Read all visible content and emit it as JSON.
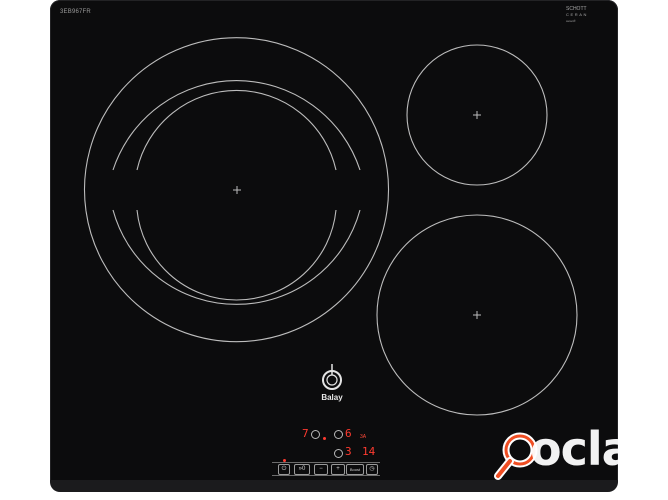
{
  "labels": {
    "model_code": "3EB967FR",
    "glass_brand": "SCHOTT",
    "glass_line": "CERAN",
    "glass_tiny": "ceran®",
    "brand_name": "Balay",
    "watermark": "oclasf"
  },
  "display": {
    "left_digit": "7",
    "left_small": "6",
    "mid_small": "3",
    "right_digits": "14",
    "tiny_label": "3A"
  },
  "controls": {
    "buttons": [
      "⏻",
      "»0",
      "−",
      "+",
      "Boost",
      "◷"
    ]
  },
  "colors": {
    "glass": "#0c0c0d",
    "zone_ring": "#bdbdbd",
    "indicator": "#ff3b30",
    "watermark_accent": "#f04e23"
  }
}
